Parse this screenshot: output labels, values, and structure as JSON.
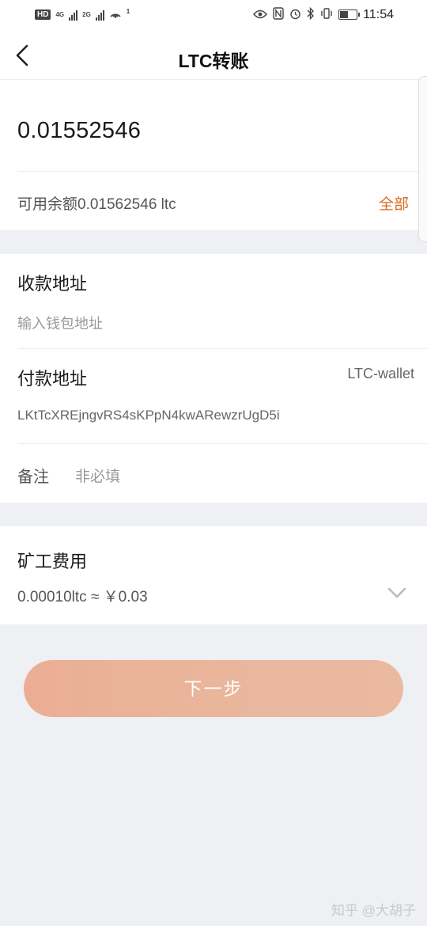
{
  "status_bar": {
    "hd_badge": "HD",
    "net_1": "4G",
    "net_2": "2G",
    "notif_count": "1",
    "time": "11:54",
    "battery_level": 0.55,
    "icons": [
      "eye-icon",
      "nfc-icon",
      "alarm-icon",
      "bluetooth-icon",
      "vibrate-icon",
      "battery-icon"
    ]
  },
  "nav": {
    "title": "LTC转账",
    "back_icon": "chevron-left-icon"
  },
  "amount": {
    "value": "0.01552546",
    "balance_text": "可用余额0.01562546 ltc",
    "all_label": "全部",
    "accent_color": "#d96a1f"
  },
  "receive": {
    "label": "收款地址",
    "placeholder": "输入钱包地址"
  },
  "pay": {
    "label": "付款地址",
    "wallet_name": "LTC-wallet",
    "address": "LKtTcXREjngvRS4sKPpN4kwARewzrUgD5i"
  },
  "memo": {
    "label": "备注",
    "placeholder": "非必填"
  },
  "fee": {
    "label": "矿工费用",
    "value": "0.00010ltc ≈ ￥0.03"
  },
  "next_button": {
    "label": "下一步",
    "color": "#ebb297"
  },
  "watermark": "知乎 @大胡子"
}
